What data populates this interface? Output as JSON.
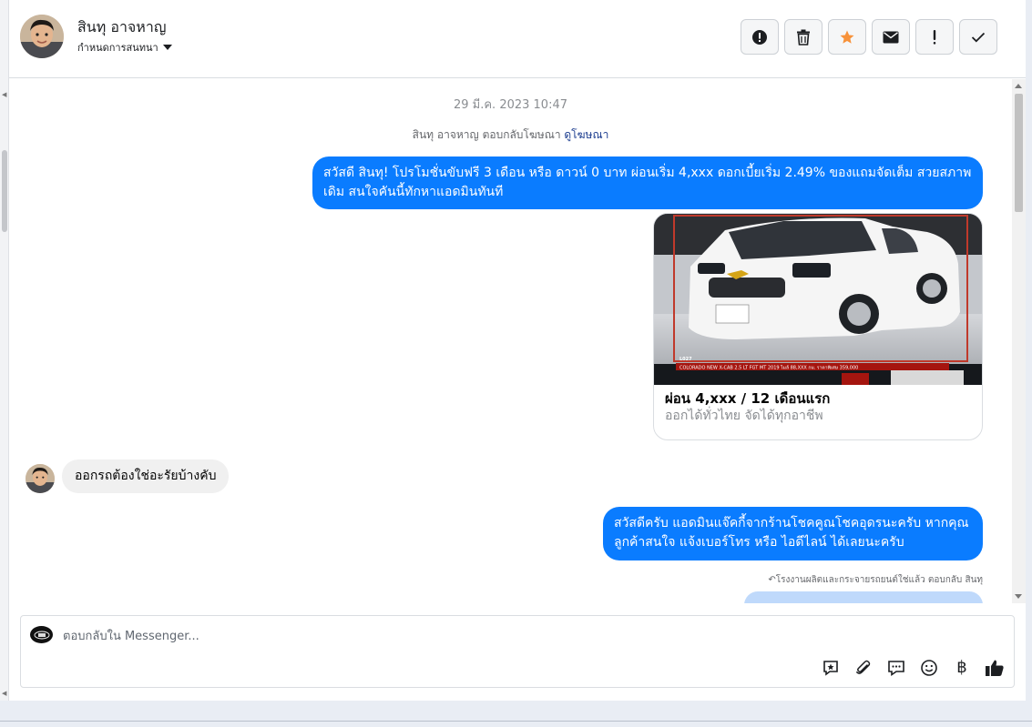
{
  "header": {
    "contact_name": "สินทุ อาจหาญ",
    "assign_label": "กำหนดการสนทนา",
    "actions": [
      {
        "name": "report-icon",
        "label": "report"
      },
      {
        "name": "trash-icon",
        "label": "delete"
      },
      {
        "name": "star-icon",
        "label": "star"
      },
      {
        "name": "envelope-icon",
        "label": "mark unread"
      },
      {
        "name": "exclamation-icon",
        "label": "follow up"
      },
      {
        "name": "check-icon",
        "label": "done"
      }
    ],
    "star_color": "#f7923a"
  },
  "chat": {
    "timestamp": "29 มี.ค. 2023 10:47",
    "reply_note_prefix": "สินทุ อาจหาญ ตอบกลับโฆษณา",
    "reply_note_link": "ดูโฆษณา",
    "messages": {
      "out1": "สวัสดี สินทุ! โปรโมชั่นขับฟรี 3 เดือน หรือ ดาวน์ 0 บาท ผ่อนเริ่ม 4,xxx ดอกเบี้ยเริ่ม 2.49% ของแถมจัดเต็ม สวยสภาพเดิม สนใจคันนี้ทักหาแอดมินทันที",
      "card_title": "ผ่อน 4,xxx / 12 เดือนแรก",
      "card_subtitle": "ออกได้ทั่วไทย จัดได้ทุกอาชีพ",
      "card_image_caption": "COLORADO NEW X-CAB 2.5 LT FGT MT 2019 ไมล์ 88,XXX กม. ราคาพิเศษ 359,000",
      "card_image_code": "L027",
      "in1": "ออกรถต้องใช่อะรัยบ้างคับ",
      "out2": "สวัสดีครับ แอดมินแจ๊คกี้จากร้านโชคคูณโชคอุดรนะครับ หากคุณลูกค้าสนใจ แจ้งเบอร์โทร หรือ ไอดีไลน์ ได้เลยนะครับ",
      "reply_note2": "โรงงานผลิตและกระจายรถยนต์ใช่แล้ว ตอบกลับ สินทุ"
    },
    "bubble_color_out": "#0a7cff",
    "bubble_color_in": "#f0f0f0"
  },
  "composer": {
    "placeholder": "ตอบกลับใน Messenger...",
    "value": "",
    "tools": [
      "saved-reply-icon",
      "attachment-icon",
      "chat-icon",
      "emoji-icon",
      "baht-icon",
      "like-icon"
    ],
    "baht_symbol": "฿"
  }
}
